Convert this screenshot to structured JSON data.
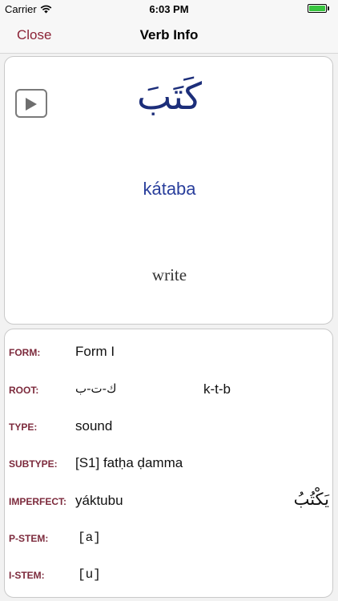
{
  "status_bar": {
    "carrier": "Carrier",
    "time": "6:03 PM"
  },
  "nav": {
    "close_label": "Close",
    "title": "Verb Info"
  },
  "verb": {
    "arabic": "كَتَبَ",
    "transliteration": "kátaba",
    "meaning": "write"
  },
  "details": {
    "form": {
      "label": "FORM:",
      "value": "Form I"
    },
    "root": {
      "label": "ROOT:",
      "value": "ك-ت-ب",
      "secondary": "k-t-b"
    },
    "type": {
      "label": "TYPE:",
      "value": "sound"
    },
    "subtype": {
      "label": "SUBTYPE:",
      "value": "[S1] fatḥa ḍamma"
    },
    "imperfect": {
      "label": "IMPERFECT:",
      "value": "yáktubu",
      "arabic": "يَكْتُبُ"
    },
    "p_stem": {
      "label": "P-STEM:",
      "value": "[a]"
    },
    "i_stem": {
      "label": "I-STEM:",
      "value": "[u]"
    }
  },
  "icons": {
    "play": "play-icon",
    "wifi": "wifi-icon",
    "battery": "battery-icon"
  },
  "colors": {
    "accent": "#8b2336",
    "label": "#7c2a3c",
    "arabic": "#1c2e7a",
    "transliteration": "#2a3f9c",
    "battery": "#38c53f"
  }
}
